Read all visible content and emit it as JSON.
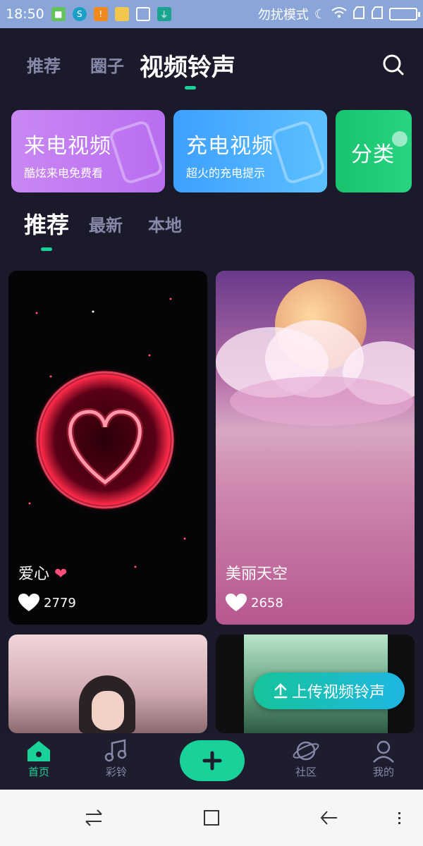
{
  "status_bar": {
    "time": "18:50",
    "dnd_text": "勿扰模式",
    "icons": [
      "notification-icon",
      "app-icon",
      "warning-icon",
      "folder-icon",
      "cleaner-icon",
      "usb-icon",
      "moon-icon",
      "wifi-icon",
      "signal-icon",
      "signal-icon",
      "battery-icon"
    ]
  },
  "top_tabs": {
    "items": [
      "推荐",
      "圈子",
      "视频铃声"
    ],
    "active": "视频铃声"
  },
  "banners": [
    {
      "title": "来电视频",
      "subtitle": "酷炫来电免费看"
    },
    {
      "title": "充电视频",
      "subtitle": "超火的充电提示"
    },
    {
      "title": "分类",
      "subtitle": ""
    }
  ],
  "sub_tabs": {
    "items": [
      "推荐",
      "最新",
      "本地"
    ],
    "active": "推荐"
  },
  "videos": [
    {
      "title": "爱心",
      "likes": "2779"
    },
    {
      "title": "美丽天空",
      "likes": "2658"
    },
    {
      "title": "",
      "likes": ""
    },
    {
      "title": "",
      "likes": ""
    }
  ],
  "upload_button": "上传视频铃声",
  "bottom_nav": {
    "items": [
      "首页",
      "彩铃",
      "社区",
      "我的"
    ],
    "active": "首页"
  },
  "colors": {
    "background": "#1b1a2b",
    "accent": "#18d29a"
  }
}
